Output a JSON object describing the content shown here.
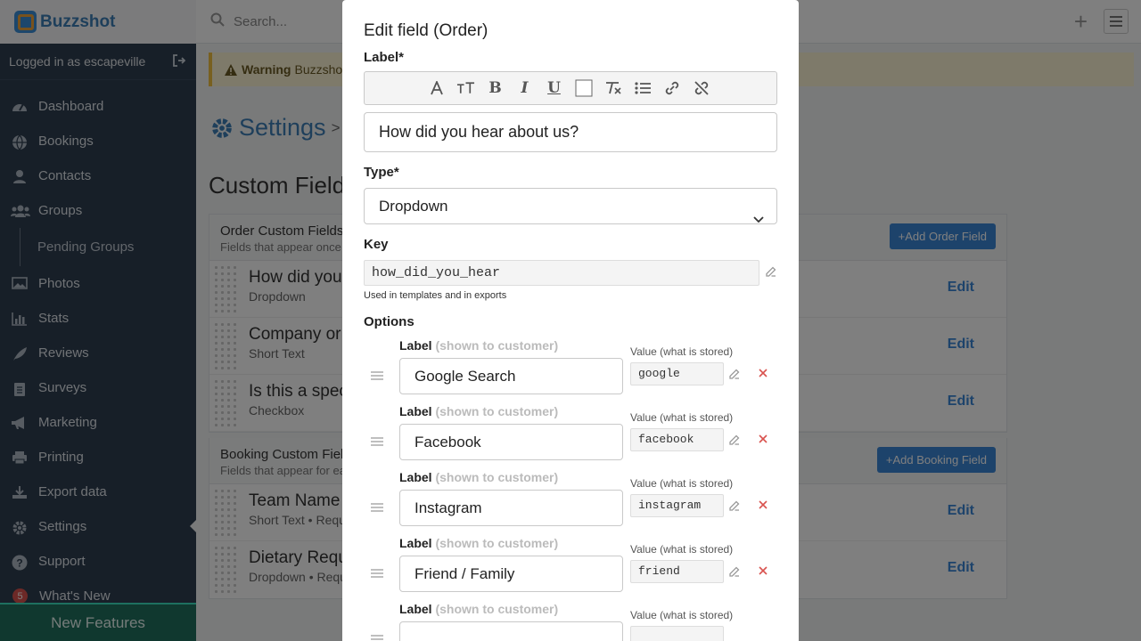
{
  "app": {
    "name": "Buzzshot"
  },
  "sidebar": {
    "logged_in": "Logged in as escapeville",
    "items": [
      {
        "label": "Dashboard",
        "icon": "dashboard-icon"
      },
      {
        "label": "Bookings",
        "icon": "globe-icon"
      },
      {
        "label": "Contacts",
        "icon": "user-icon"
      },
      {
        "label": "Groups",
        "icon": "users-icon"
      },
      {
        "label": "Pending Groups",
        "icon": ""
      },
      {
        "label": "Photos",
        "icon": "image-icon"
      },
      {
        "label": "Stats",
        "icon": "bar-chart-icon"
      },
      {
        "label": "Reviews",
        "icon": "feather-icon"
      },
      {
        "label": "Surveys",
        "icon": "clipboard-icon"
      },
      {
        "label": "Marketing",
        "icon": "bullhorn-icon"
      },
      {
        "label": "Printing",
        "icon": "printer-icon"
      },
      {
        "label": "Export data",
        "icon": "download-icon"
      },
      {
        "label": "Settings",
        "icon": "gear-icon"
      },
      {
        "label": "Support",
        "icon": "question-icon"
      }
    ],
    "whats_new_badge": "5",
    "whats_new": "What's New",
    "new_features": "New Features"
  },
  "topbar": {
    "search_placeholder": "Search..."
  },
  "warning": {
    "strong": "Warning",
    "text": "Buzzshot"
  },
  "page": {
    "title": "Settings",
    "crumb": "> Cust",
    "section_title": "Custom Fields",
    "order_panel": {
      "title": "Order Custom Fields",
      "desc": "Fields that appear once p",
      "add": "+Add Order Field",
      "rows": [
        {
          "name": "How did you",
          "type": "Dropdown",
          "edit": "Edit"
        },
        {
          "name": "Company or",
          "type": "Short Text",
          "edit": "Edit"
        },
        {
          "name": "Is this a spec",
          "type": "Checkbox",
          "edit": "Edit"
        }
      ]
    },
    "booking_panel": {
      "title": "Booking Custom Field",
      "desc": "Fields that appear for eac",
      "add": "+Add Booking Field",
      "rows": [
        {
          "name": "Team Name",
          "type": "Short Text • Requ",
          "edit": "Edit"
        },
        {
          "name": "Dietary Requ",
          "type": "Dropdown • Requ",
          "edit": "Edit"
        }
      ]
    }
  },
  "modal": {
    "title": "Edit field (Order)",
    "label_label": "Label*",
    "label_value": "How did you hear about us?",
    "type_label": "Type*",
    "type_value": "Dropdown",
    "key_label": "Key",
    "key_value": "how_did_you_hear",
    "key_help": "Used in templates and in exports",
    "options_label": "Options",
    "option_label_text": "Label",
    "option_label_hint": "(shown to customer)",
    "option_value_text": "Value (what is stored)",
    "options": [
      {
        "label": "Google Search",
        "value": "google"
      },
      {
        "label": "Facebook",
        "value": "facebook"
      },
      {
        "label": "Instagram",
        "value": "instagram"
      },
      {
        "label": "Friend / Family",
        "value": "friend"
      },
      {
        "label": "",
        "value": ""
      }
    ]
  },
  "colors": {
    "accent": "#3b86d6",
    "sidebar": "#2f3e50",
    "danger": "#d9534f",
    "new_features": "#21705f"
  }
}
